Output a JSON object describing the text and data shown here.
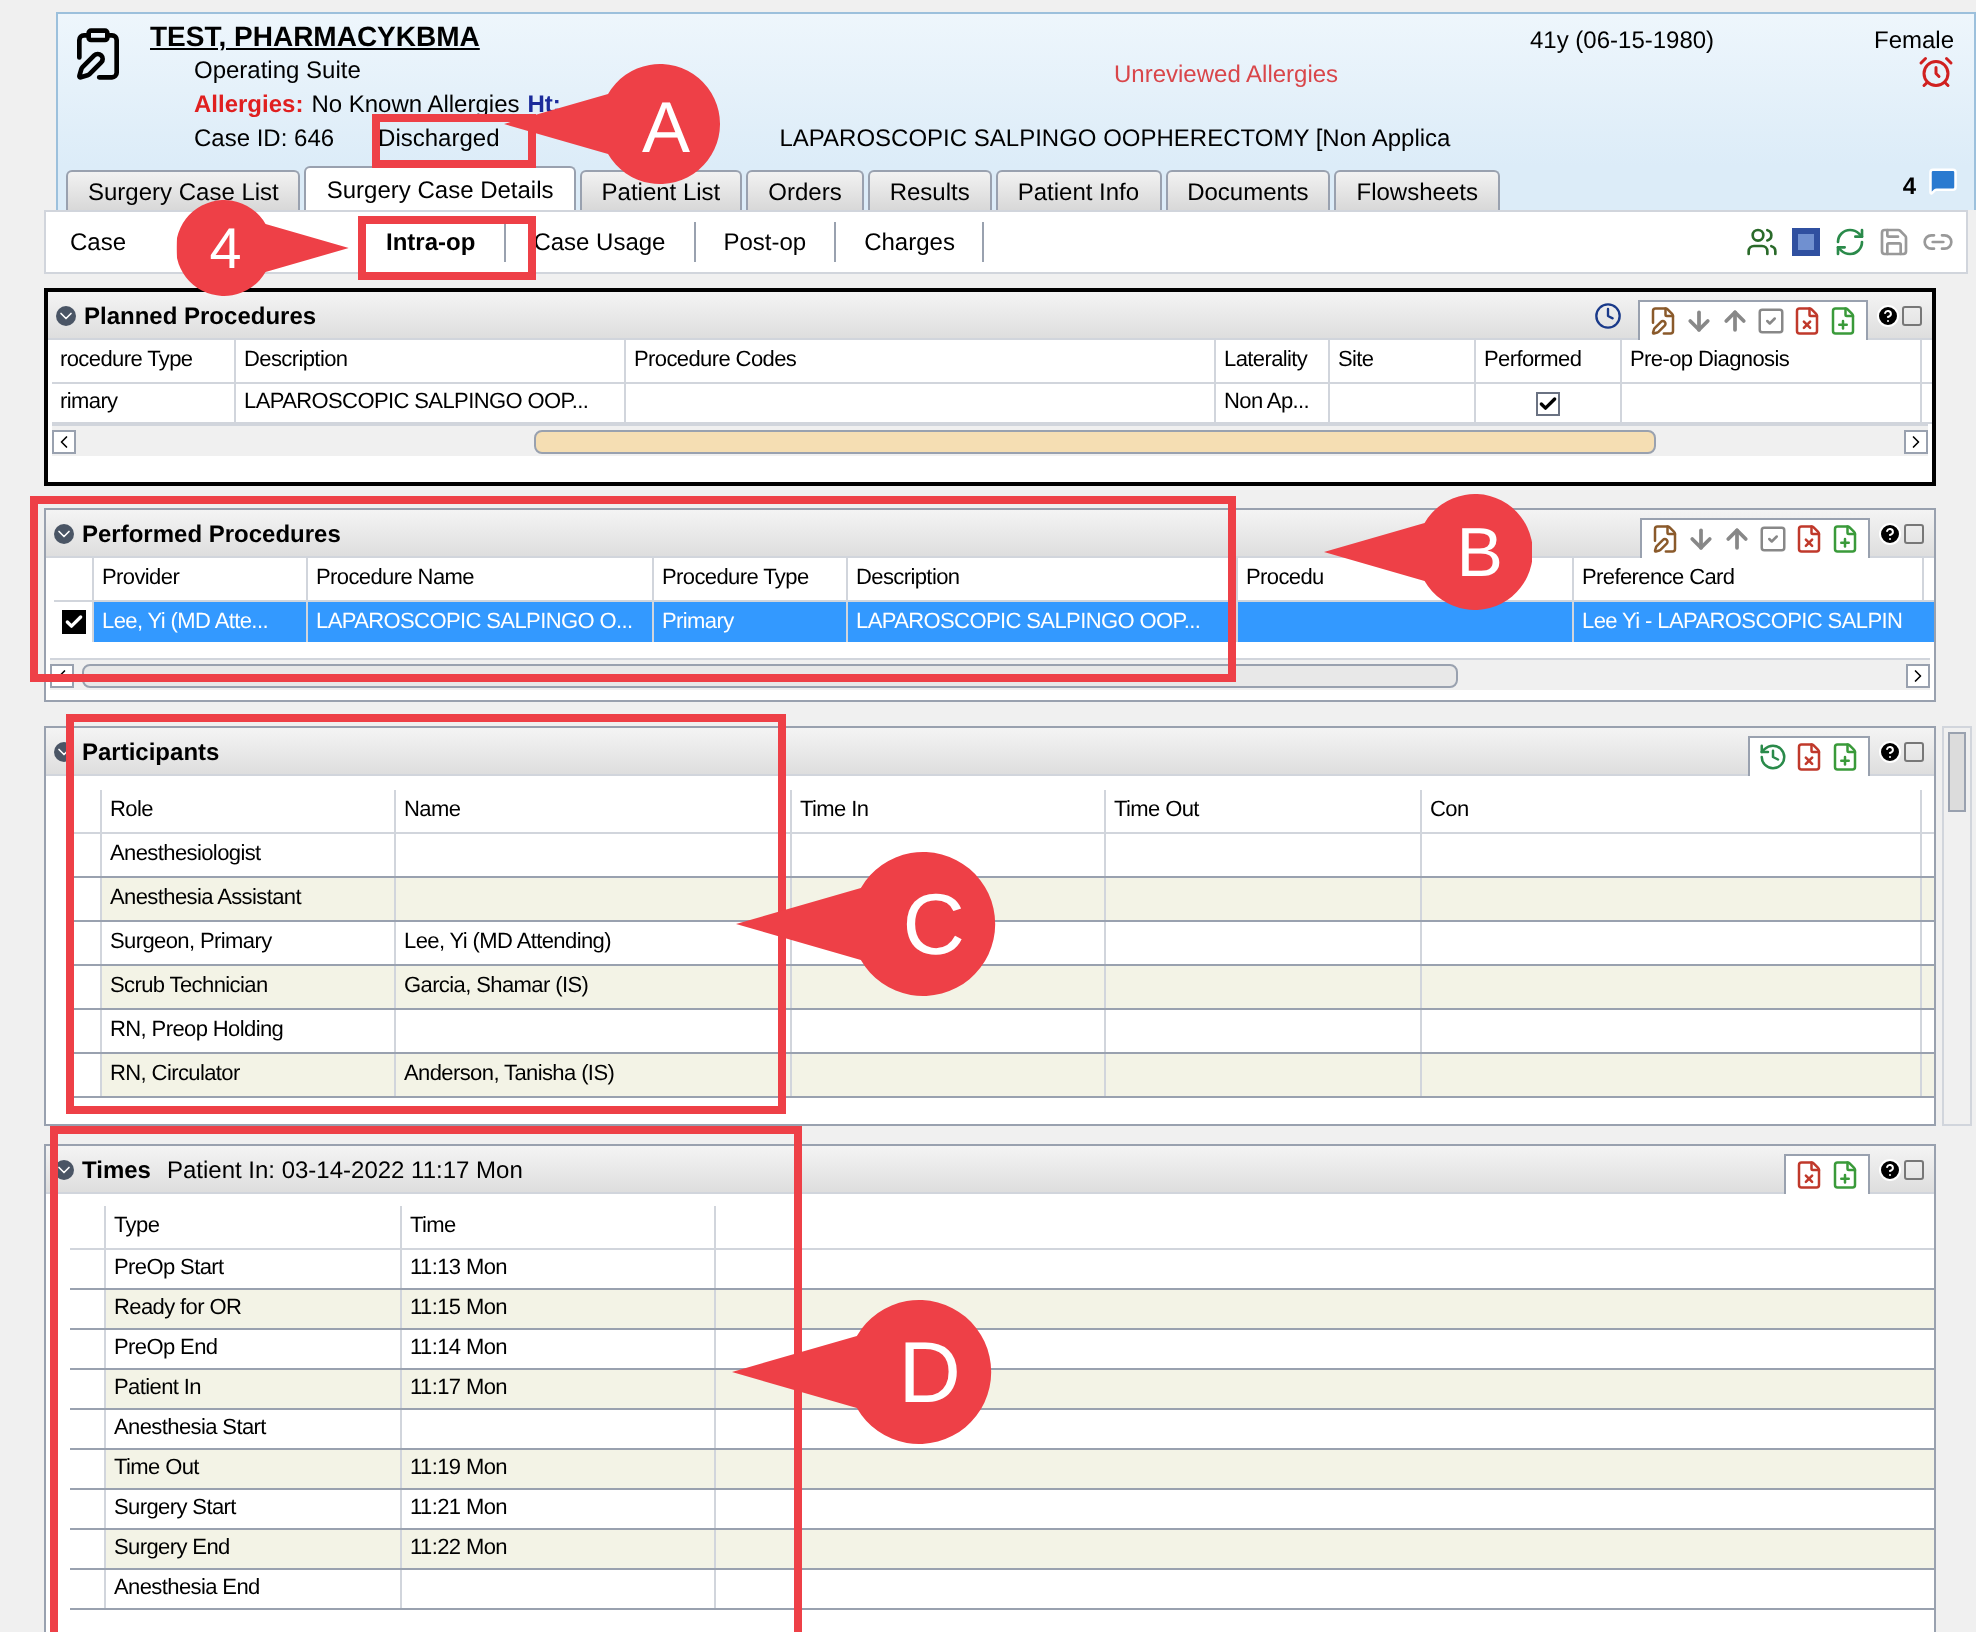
{
  "patient": {
    "name": "TEST, PHARMACYKBMA",
    "location": "Operating Suite",
    "allergies_label": "Allergies:",
    "allergies_value": "No Known Allergies",
    "height_label": "Ht:",
    "alert": "Unreviewed Allergies",
    "age": "41y (06-15-1980)",
    "sex": "Female",
    "case_id": "Case ID: 646",
    "status": "Discharged",
    "procedure": "LAPAROSCOPIC SALPINGO OOPHERECTOMY [Non Applica"
  },
  "tabs": [
    {
      "label": "Surgery Case List",
      "selected": false
    },
    {
      "label": "Surgery Case Details",
      "selected": true
    },
    {
      "label": "Patient List",
      "selected": false
    },
    {
      "label": "Orders",
      "selected": false
    },
    {
      "label": "Results",
      "selected": false
    },
    {
      "label": "Patient Info",
      "selected": false
    },
    {
      "label": "Documents",
      "selected": false
    },
    {
      "label": "Flowsheets",
      "selected": false
    }
  ],
  "tab_badge": "4",
  "subtabs": [
    {
      "label": "Case",
      "selected": false
    },
    {
      "label": "Intra-op",
      "selected": true
    },
    {
      "label": "Case Usage",
      "selected": false
    },
    {
      "label": "Post-op",
      "selected": false
    },
    {
      "label": "Charges",
      "selected": false
    }
  ],
  "planned_procedures": {
    "title": "Planned Procedures",
    "columns": [
      "rocedure Type",
      "Description",
      "Procedure Codes",
      "Laterality",
      "Site",
      "Performed",
      "Pre-op Diagnosis"
    ],
    "rows": [
      {
        "type": "rimary",
        "description": "LAPAROSCOPIC SALPINGO OOP...",
        "laterality": "Non Ap...",
        "performed": true
      }
    ]
  },
  "performed_procedures": {
    "title": "Performed Procedures",
    "columns": [
      "Provider",
      "Procedure Name",
      "Procedure Type",
      "Description",
      "Procedu",
      "Preference Card"
    ],
    "rows": [
      {
        "checked": true,
        "selected": true,
        "provider": "Lee, Yi (MD Atte...",
        "procedure_name": "LAPAROSCOPIC SALPINGO O...",
        "procedure_type": "Primary",
        "description": "LAPAROSCOPIC SALPINGO OOP...",
        "preference_card": "Lee Yi -  LAPAROSCOPIC SALPIN"
      }
    ]
  },
  "participants": {
    "title": "Participants",
    "columns": [
      "Role",
      "Name",
      "Time In",
      "Time Out",
      "Con"
    ],
    "rows": [
      {
        "role": "Anesthesiologist"
      },
      {
        "role": "Anesthesia Assistant"
      },
      {
        "role": "Surgeon, Primary",
        "name": "Lee, Yi (MD Attending)"
      },
      {
        "role": "Scrub Technician",
        "name": "Garcia, Shamar (IS)"
      },
      {
        "role": "RN, Preop Holding"
      },
      {
        "role": "RN, Circulator",
        "name": "Anderson, Tanisha (IS)"
      }
    ]
  },
  "times": {
    "title": "Times",
    "subtitle": "Patient In: 03-14-2022 11:17 Mon",
    "columns": [
      "Type",
      "Time"
    ],
    "rows": [
      {
        "type": "PreOp Start",
        "time": "11:13 Mon"
      },
      {
        "type": "Ready for OR",
        "time": "11:15 Mon"
      },
      {
        "type": "PreOp End",
        "time": "11:14 Mon"
      },
      {
        "type": "Patient In",
        "time": "11:17 Mon"
      },
      {
        "type": "Anesthesia Start"
      },
      {
        "type": "Time Out",
        "time": "11:19 Mon"
      },
      {
        "type": "Surgery Start",
        "time": "11:21 Mon"
      },
      {
        "type": "Surgery End",
        "time": "11:22 Mon"
      },
      {
        "type": "Anesthesia End"
      }
    ]
  },
  "annotations": [
    {
      "label": "A"
    },
    {
      "label": "4"
    },
    {
      "label": "B"
    },
    {
      "label": "C"
    },
    {
      "label": "D"
    }
  ]
}
